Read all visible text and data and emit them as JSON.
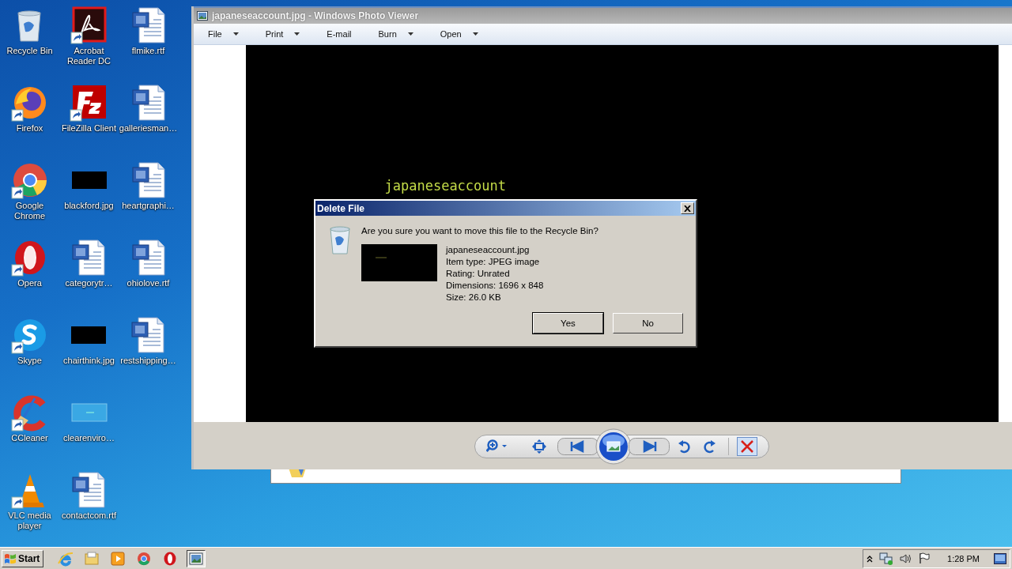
{
  "desktop_icons": [
    {
      "label": "Recycle Bin",
      "kind": "recycle-bin",
      "shortcut": false
    },
    {
      "label": "Firefox",
      "kind": "firefox",
      "shortcut": true
    },
    {
      "label": "Google Chrome",
      "kind": "chrome",
      "shortcut": true
    },
    {
      "label": "Opera",
      "kind": "opera",
      "shortcut": true
    },
    {
      "label": "Skype",
      "kind": "skype",
      "shortcut": true
    },
    {
      "label": "CCleaner",
      "kind": "ccleaner",
      "shortcut": true
    },
    {
      "label": "VLC media player",
      "kind": "vlc",
      "shortcut": true
    },
    {
      "label": "Acrobat Reader DC",
      "kind": "acrobat",
      "shortcut": true
    },
    {
      "label": "FileZilla Client",
      "kind": "filezilla",
      "shortcut": true
    },
    {
      "label": "blackford.jpg",
      "kind": "dark-image",
      "shortcut": false
    },
    {
      "label": "categorytr…",
      "kind": "document",
      "shortcut": false
    },
    {
      "label": "chairthink.jpg",
      "kind": "dark-image",
      "shortcut": false
    },
    {
      "label": "clearenviro…",
      "kind": "light-image",
      "shortcut": false
    },
    {
      "label": "contactcom.rtf",
      "kind": "document",
      "shortcut": false
    },
    {
      "label": "flmike.rtf",
      "kind": "document",
      "shortcut": false
    },
    {
      "label": "galleriesman…",
      "kind": "document",
      "shortcut": false
    },
    {
      "label": "heartgraphi…",
      "kind": "document",
      "shortcut": false
    },
    {
      "label": "ohiolove.rtf",
      "kind": "document",
      "shortcut": false
    },
    {
      "label": "restshipping…",
      "kind": "document",
      "shortcut": false
    }
  ],
  "viewer": {
    "title": "japaneseaccount.jpg - Windows Photo Viewer",
    "menu": [
      {
        "label": "File",
        "has_menu": true
      },
      {
        "label": "Print",
        "has_menu": true
      },
      {
        "label": "E-mail",
        "has_menu": false
      },
      {
        "label": "Burn",
        "has_menu": true
      },
      {
        "label": "Open",
        "has_menu": true
      }
    ],
    "image_text": "japaneseaccount"
  },
  "dialog": {
    "title": "Delete File",
    "question": "Are you sure you want to move this file to the Recycle Bin?",
    "details": [
      "japaneseaccount.jpg",
      "Item type: JPEG image",
      "Rating: Unrated",
      "Dimensions: 1696 x 848",
      "Size: 26.0 KB"
    ],
    "buttons": [
      {
        "label": "Yes",
        "default": true
      },
      {
        "label": "No",
        "default": false
      }
    ]
  },
  "taskbar": {
    "start": "Start",
    "apps": [
      {
        "kind": "ie",
        "active": false
      },
      {
        "kind": "explorer",
        "active": false
      },
      {
        "kind": "media-player",
        "active": false
      },
      {
        "kind": "chrome",
        "active": false
      },
      {
        "kind": "opera",
        "active": false
      },
      {
        "kind": "photo-viewer",
        "active": true
      }
    ],
    "clock": "1:28 PM"
  }
}
